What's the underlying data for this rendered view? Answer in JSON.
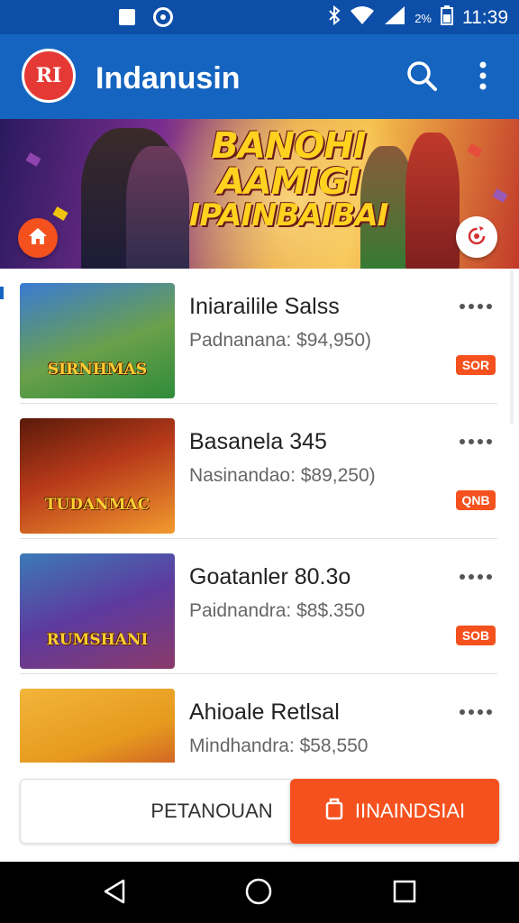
{
  "status_bar": {
    "time": "11:39",
    "battery_text": "2%"
  },
  "app_bar": {
    "logo_text": "RI",
    "title": "Indanusin"
  },
  "banner": {
    "lines": [
      "BANOHI",
      "AAMIGI",
      "IPAINBAIBAI"
    ]
  },
  "list": {
    "items": [
      {
        "title": "Iniarailile Salѕs",
        "price": "Padnanana: $94,950)",
        "badge": "SOR",
        "thumb_label": "SIRNHMAS",
        "thumb_colors": [
          "#3b7bd4",
          "#2e8b3a"
        ]
      },
      {
        "title": "Basanela 345",
        "price": "Nasinandao: $89,250)",
        "badge": "QNB",
        "thumb_label": "TUDANMAC",
        "thumb_colors": [
          "#b83a1a",
          "#f29a2e"
        ]
      },
      {
        "title": "Goatanler 80.3o",
        "price": "Paidnandra: $8$.350",
        "badge": "SOB",
        "thumb_label": "RUMSHANI",
        "thumb_colors": [
          "#5e3a9e",
          "#3c7ab8"
        ]
      },
      {
        "title": "Ahioale Retlsal",
        "price": "Mindhandra: $58,550",
        "badge": "",
        "thumb_label": "",
        "thumb_colors": [
          "#e69a1e",
          "#c0392b"
        ]
      }
    ]
  },
  "bottom_actions": {
    "secondary_label": "PETANOUAN",
    "primary_label": "IINAINDSIAI"
  },
  "colors": {
    "primary": "#1565c0",
    "accent": "#f4511e"
  }
}
